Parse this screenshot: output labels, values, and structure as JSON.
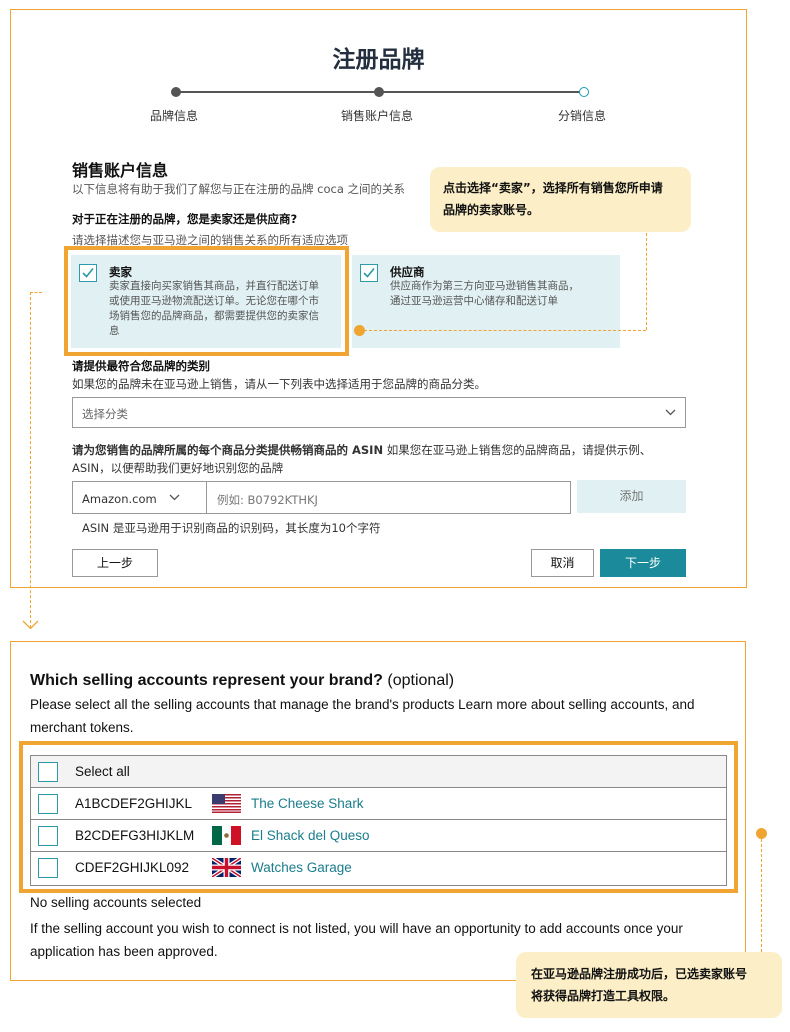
{
  "form": {
    "title": "注册品牌",
    "steps": [
      "品牌信息",
      "销售账户信息",
      "分销信息"
    ],
    "section_title": "销售账户信息",
    "section_desc": "以下信息将有助于我们了解您与正在注册的品牌 coca 之间的关系",
    "question": "对于正在注册的品牌，您是卖家还是供应商?",
    "question_hint": "请选择描述您与亚马逊之间的销售关系的所有适应选项",
    "seller": {
      "title": "卖家",
      "desc": [
        "卖家直接向买家销售其商品，并直行配送订单",
        "或使用亚马逊物流配送订单。无论您在哪个市",
        "场销售您的品牌商品，都需要提供您的卖家信",
        "息"
      ],
      "checked": true
    },
    "vendor": {
      "title": "供应商",
      "desc": [
        "供应商作为第三方向亚马逊销售其商品，",
        "通过亚马逊运营中心储存和配送订单"
      ],
      "checked": true
    },
    "category_label": "请提供最符合您品牌的类别",
    "category_hint": "如果您的品牌未在亚马逊上销售，请从一下列表中选择适用于您品牌的商品分类。",
    "category_placeholder": "选择分类",
    "asin_label_bold": "请为您销售的品牌所属的每个商品分类提供畅销商品的 ASIN",
    "asin_label_rest": " 如果您在亚马逊上销售您的品牌商品，请提供示例、",
    "asin_label_line2": "ASIN，以便帮助我们更好地识别您的品牌",
    "marketplace": "Amazon.com",
    "asin_placeholder": "例如: B0792KTHKJ",
    "add_label": "添加",
    "asin_note": "ASIN 是亚马逊用于识别商品的识别码，其长度为10个字符",
    "back_label": "上一步",
    "cancel_label": "取消",
    "next_label": "下一步"
  },
  "callouts": {
    "top": [
      "点击选择“卖家”，选择所有销售您所申请",
      "品牌的卖家账号。"
    ],
    "bottom": [
      "在亚马逊品牌注册成功后，已选卖家账号",
      "将获得品牌打造工具权限。"
    ]
  },
  "accounts": {
    "heading": "Which selling accounts represent your brand?",
    "optional": " (optional)",
    "desc_line1": "Please select all the selling accounts that manage the brand's products Learn more about selling accounts, and",
    "desc_line2": "merchant tokens.",
    "select_all": "Select all",
    "rows": [
      {
        "id": "A1BCDEF2GHIJKL",
        "flag": "us-flag-icon",
        "name": "The Cheese Shark"
      },
      {
        "id": "B2CDEFG3HIJKLM",
        "flag": "mx-flag-icon",
        "name": "El Shack del Queso"
      },
      {
        "id": "CDEF2GHIJKL092",
        "flag": "uk-flag-icon",
        "name": "Watches Garage"
      }
    ],
    "none_selected": "No selling accounts selected",
    "footer_line1": "If the selling account you wish to connect is not listed, you will have an opportunity to add accounts once your",
    "footer_line2": "application has been approved."
  },
  "colors": {
    "accent_orange": "#f0a532",
    "teal": "#1b8a9a",
    "card_bg": "#e1f0f2",
    "callout_bg": "#fcefc7",
    "link": "#1b7d8c"
  }
}
